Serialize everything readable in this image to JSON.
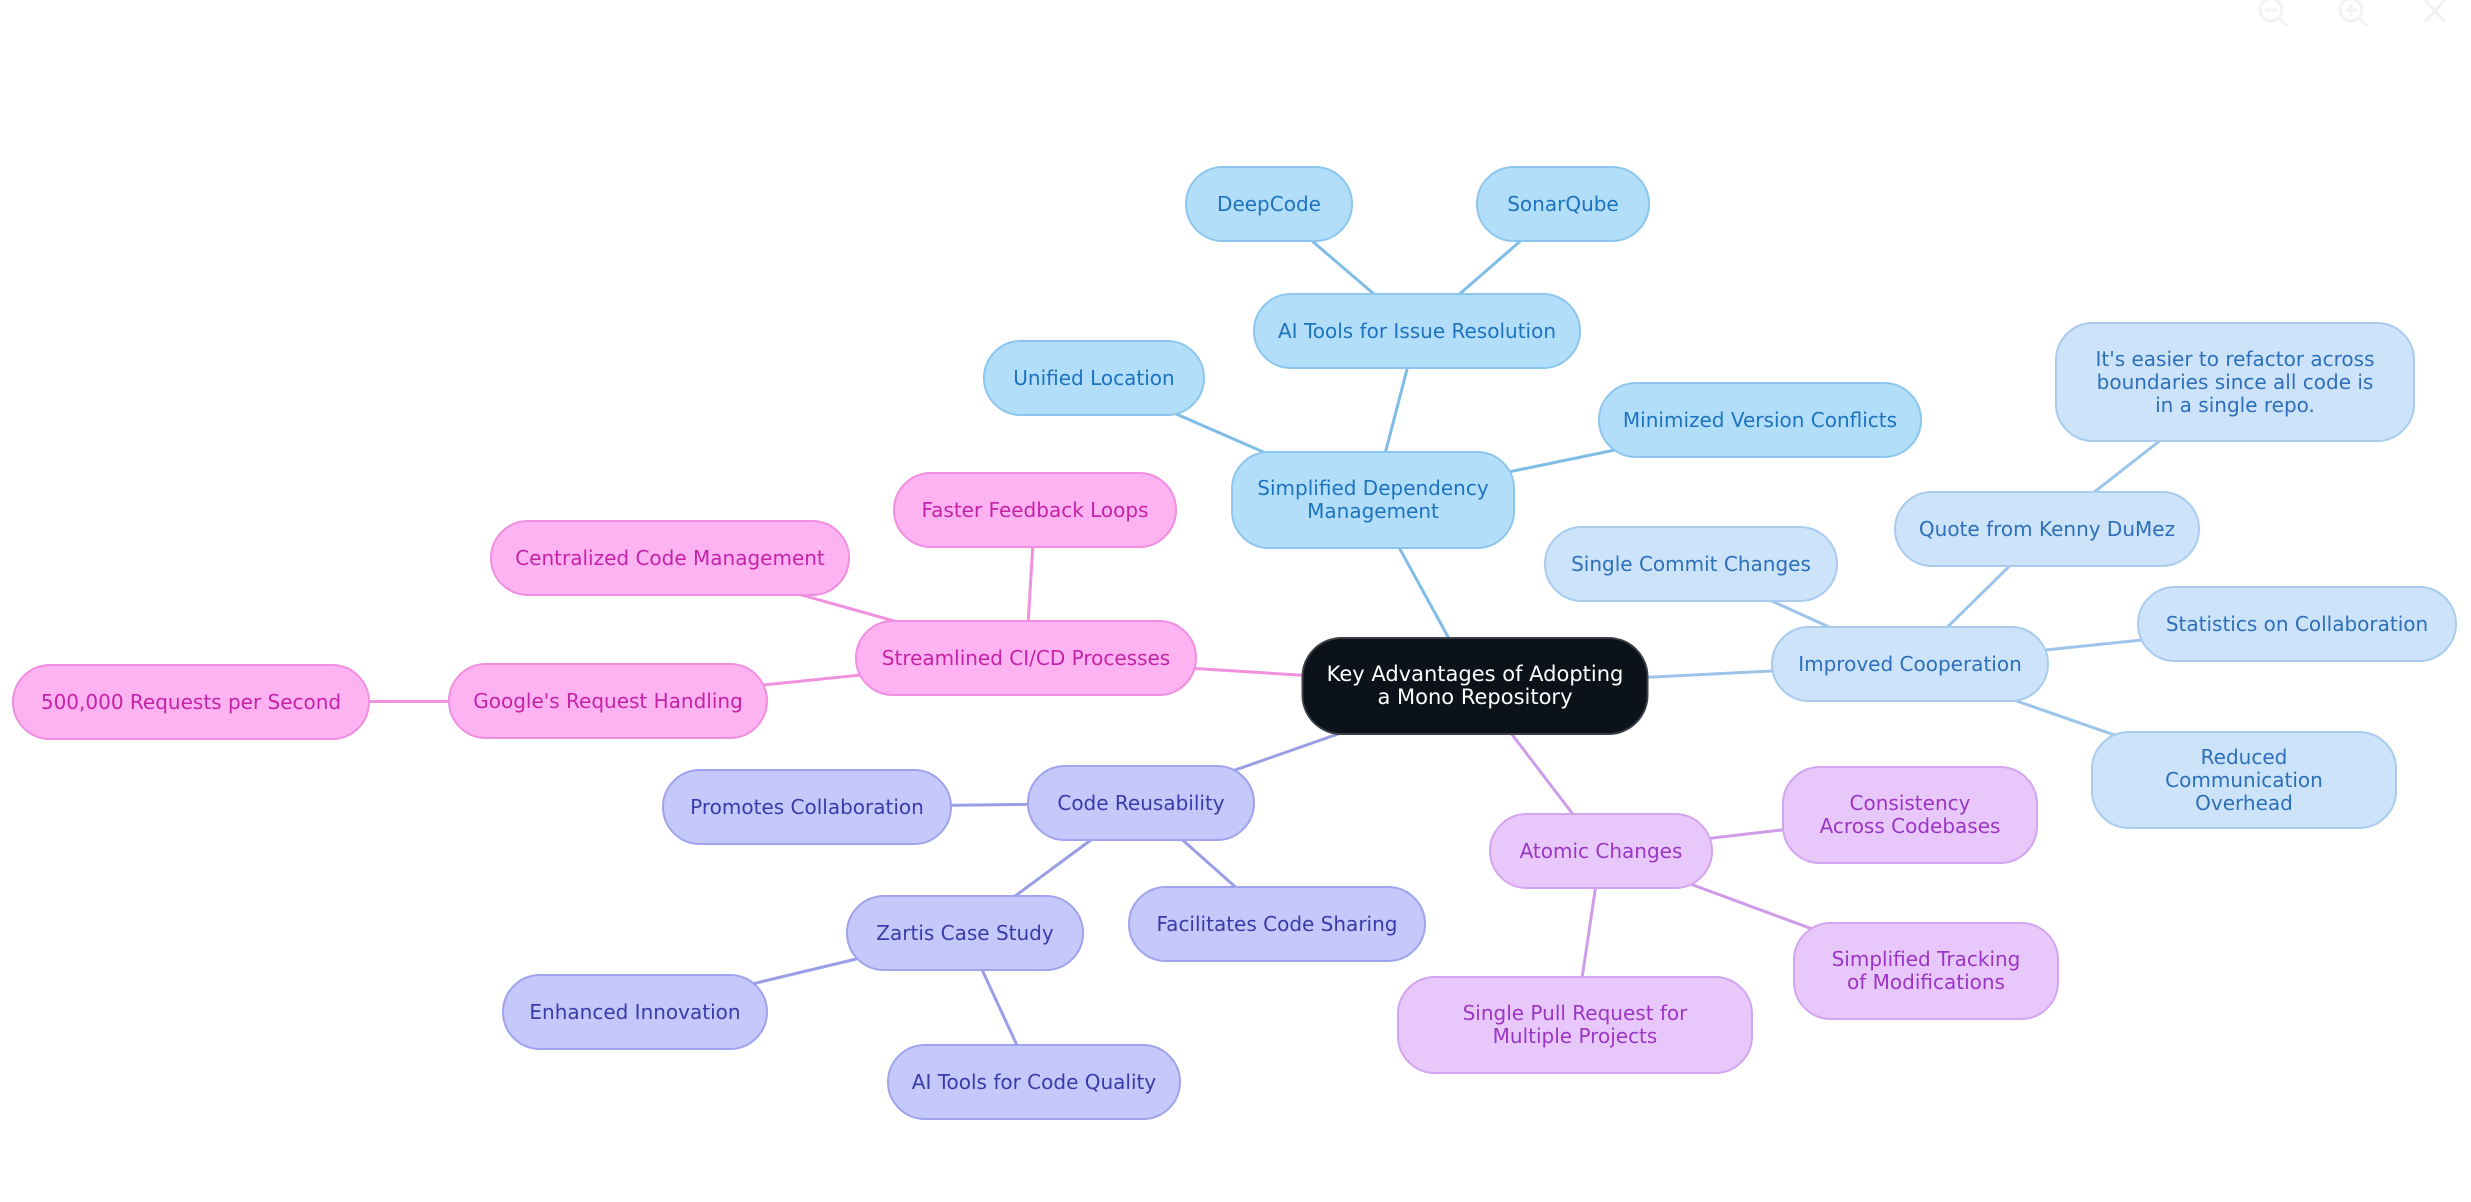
{
  "toolbar": {
    "zoom_out_icon": "zoom-out-icon",
    "zoom_in_icon": "zoom-in-icon",
    "close_icon": "close-icon"
  },
  "mindmap": {
    "root": "Key Advantages of Adopting a Mono Repository",
    "colors": {
      "root_bg": "#0c1219",
      "blue": "#b3defa",
      "light_blue": "#cce3fa",
      "pink": "#fdb2f1",
      "violet": "#c5c8fb",
      "purple": "#e8c8fb"
    },
    "nodes": {
      "simplified_dependency": "Simplified Dependency Management",
      "ai_tools_issue": "AI Tools for Issue Resolution",
      "deepcode": "DeepCode",
      "sonarqube": "SonarQube",
      "unified_location": "Unified Location",
      "minimized_conflicts": "Minimized Version Conflicts",
      "improved_cooperation": "Improved Cooperation",
      "single_commit": "Single Commit Changes",
      "quote_kenny": "Quote from Kenny DuMez",
      "quote_text": "It's easier to refactor across boundaries since all code is in a single repo.",
      "statistics": "Statistics on Collaboration",
      "reduced_comm": "Reduced Communication Overhead",
      "atomic_changes": "Atomic Changes",
      "consistency": "Consistency Across Codebases",
      "simplified_tracking": "Simplified Tracking of Modifications",
      "single_pr": "Single Pull Request for Multiple Projects",
      "code_reusability": "Code Reusability",
      "promotes_collab": "Promotes Collaboration",
      "facilitates_sharing": "Facilitates Code Sharing",
      "zartis": "Zartis Case Study",
      "enhanced_innovation": "Enhanced Innovation",
      "ai_tools_quality": "AI Tools for Code Quality",
      "streamlined_cicd": "Streamlined CI/CD Processes",
      "faster_feedback": "Faster Feedback Loops",
      "centralized": "Centralized Code Management",
      "google_requests": "Google's Request Handling",
      "requests_per_second": "500,000 Requests per Second"
    },
    "edges": [
      [
        "root",
        "simplified_dependency"
      ],
      [
        "simplified_dependency",
        "ai_tools_issue"
      ],
      [
        "ai_tools_issue",
        "deepcode"
      ],
      [
        "ai_tools_issue",
        "sonarqube"
      ],
      [
        "simplified_dependency",
        "unified_location"
      ],
      [
        "simplified_dependency",
        "minimized_conflicts"
      ],
      [
        "root",
        "improved_cooperation"
      ],
      [
        "improved_cooperation",
        "single_commit"
      ],
      [
        "improved_cooperation",
        "quote_kenny"
      ],
      [
        "quote_kenny",
        "quote_text"
      ],
      [
        "improved_cooperation",
        "statistics"
      ],
      [
        "improved_cooperation",
        "reduced_comm"
      ],
      [
        "root",
        "atomic_changes"
      ],
      [
        "atomic_changes",
        "consistency"
      ],
      [
        "atomic_changes",
        "simplified_tracking"
      ],
      [
        "atomic_changes",
        "single_pr"
      ],
      [
        "root",
        "code_reusability"
      ],
      [
        "code_reusability",
        "promotes_collab"
      ],
      [
        "code_reusability",
        "facilitates_sharing"
      ],
      [
        "code_reusability",
        "zartis"
      ],
      [
        "zartis",
        "enhanced_innovation"
      ],
      [
        "zartis",
        "ai_tools_quality"
      ],
      [
        "root",
        "streamlined_cicd"
      ],
      [
        "streamlined_cicd",
        "faster_feedback"
      ],
      [
        "streamlined_cicd",
        "centralized"
      ],
      [
        "streamlined_cicd",
        "google_requests"
      ],
      [
        "google_requests",
        "requests_per_second"
      ]
    ]
  }
}
